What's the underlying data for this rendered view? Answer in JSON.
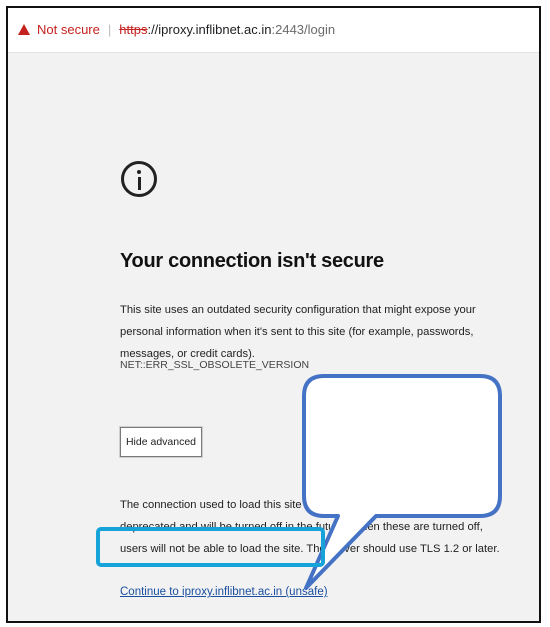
{
  "address_bar": {
    "security_label": "Not secure",
    "separator": "|",
    "scheme": "https",
    "host": "://iproxy.inflibnet.ac.in",
    "path": ":2443/login"
  },
  "page": {
    "title": "Your connection isn't secure",
    "description": "This site uses an outdated security configuration that might expose your personal information when it's sent to this site (for example, passwords, messages, or credit cards).",
    "error_code": "NET::ERR_SSL_OBSOLETE_VERSION",
    "hide_advanced_label": "Hide advanced",
    "explanation": "The connection used to load this site is TLS 1.0 or TLS 1.1, which are deprecated and will be turned off in the future. When these are turned off, users will not be able to load the site. The server should use TLS 1.2 or later.",
    "continue_link": "Continue to iproxy.inflibnet.ac.in (unsafe)"
  },
  "colors": {
    "warning_red": "#c5221f",
    "link_blue": "#1a4fa0",
    "callout_fill": "#ffffff",
    "callout_stroke": "#4472c4",
    "highlight_border": "#16a3d9"
  },
  "icons": {
    "warning": "warning-triangle-icon",
    "info": "info-circle-icon"
  }
}
